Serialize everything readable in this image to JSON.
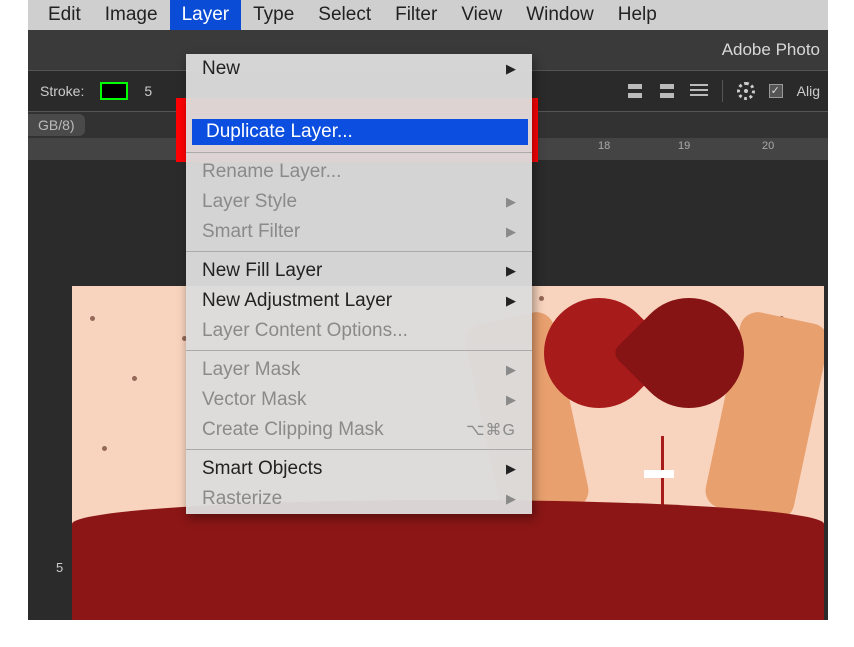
{
  "menubar": {
    "items": [
      {
        "label": "Edit"
      },
      {
        "label": "Image"
      },
      {
        "label": "Layer"
      },
      {
        "label": "Type"
      },
      {
        "label": "Select"
      },
      {
        "label": "Filter"
      },
      {
        "label": "View"
      },
      {
        "label": "Window"
      },
      {
        "label": "Help"
      }
    ],
    "active_index": 2
  },
  "app_title": "Adobe Photo",
  "options_bar": {
    "stroke_label": "Stroke:",
    "stroke_value": "5",
    "align_checkbox_label": "Alig"
  },
  "document_tab": {
    "label": "GB/8)"
  },
  "ruler": {
    "marks": [
      "",
      "18",
      "19",
      "20"
    ]
  },
  "vruler_mark": "5",
  "layer_menu": {
    "items": [
      {
        "label": "New",
        "enabled": true,
        "submenu": true
      },
      {
        "label": "Duplicate Layer...",
        "enabled": true,
        "highlighted": true
      },
      {
        "label": "Rename Layer...",
        "enabled": false
      },
      {
        "label": "Layer Style",
        "enabled": false,
        "submenu": true
      },
      {
        "label": "Smart Filter",
        "enabled": false,
        "submenu": true
      },
      {
        "label": "New Fill Layer",
        "enabled": true,
        "submenu": true
      },
      {
        "label": "New Adjustment Layer",
        "enabled": true,
        "submenu": true
      },
      {
        "label": "Layer Content Options...",
        "enabled": false
      },
      {
        "label": "Layer Mask",
        "enabled": false,
        "submenu": true
      },
      {
        "label": "Vector Mask",
        "enabled": false,
        "submenu": true
      },
      {
        "label": "Create Clipping Mask",
        "enabled": false,
        "shortcut": "⌥⌘G"
      },
      {
        "label": "Smart Objects",
        "enabled": true,
        "submenu": true
      },
      {
        "label": "Rasterize",
        "enabled": false,
        "submenu": true
      }
    ]
  }
}
